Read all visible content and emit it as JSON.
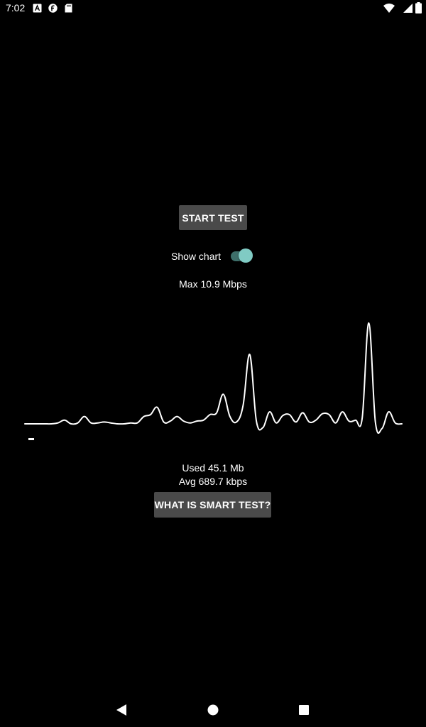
{
  "status_bar": {
    "time": "7:02",
    "left_icons": [
      "a-notification-icon",
      "f-notification-icon",
      "sd-card-icon"
    ],
    "right_icons": [
      "wifi-icon",
      "cellular-signal-icon",
      "battery-icon"
    ]
  },
  "main": {
    "start_button_label": "START TEST",
    "show_chart_label": "Show chart",
    "show_chart_enabled": true,
    "max_text": "Max 10.9 Mbps",
    "used_text": "Used 45.1 Mb",
    "avg_text": "Avg 689.7 kbps",
    "smart_button_label": "WHAT IS SMART TEST?"
  },
  "chart_data": {
    "type": "line",
    "title": "",
    "xlabel": "",
    "ylabel": "",
    "grid": false,
    "line_color": "#ffffff",
    "ylim": [
      -0.8,
      10.9
    ],
    "values": [
      0,
      0,
      0,
      0,
      0,
      0.1,
      0.4,
      0,
      0.1,
      0.8,
      0.1,
      0.1,
      0.2,
      0.1,
      0,
      0,
      0.1,
      0.1,
      0.8,
      1.0,
      1.8,
      0.2,
      0.3,
      0.8,
      0.3,
      0.1,
      0.3,
      0.4,
      1.0,
      1.2,
      3.2,
      0.8,
      0.2,
      2.0,
      7.5,
      0.3,
      -0.4,
      1.3,
      0.1,
      0.9,
      1.0,
      0.2,
      1.2,
      0.2,
      0.4,
      1.1,
      1.0,
      0.1,
      1.3,
      0.3,
      0.4,
      0.6,
      10.9,
      0.2,
      -0.5,
      1.3,
      0.1,
      0
    ]
  },
  "nav_bar": {
    "icons": [
      "back-icon",
      "home-icon",
      "recents-icon"
    ]
  },
  "colors": {
    "background": "#000000",
    "button_bg": "#4a4a4a",
    "switch_thumb": "#80cbc4",
    "switch_track": "#3e6f6a"
  }
}
